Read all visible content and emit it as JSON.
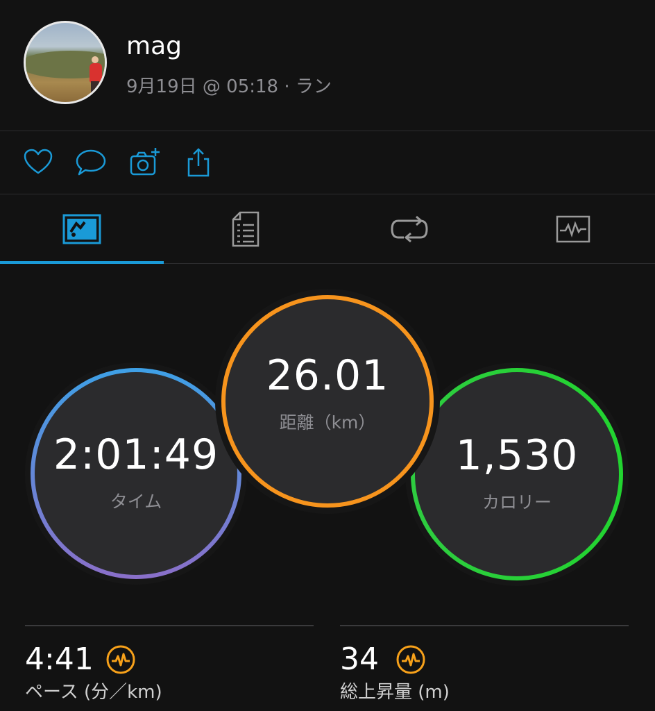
{
  "header": {
    "username": "mag",
    "subtitle": "9月19日 @ 05:18 · ラン"
  },
  "actions": [
    "heart-icon",
    "comment-icon",
    "add-photo-icon",
    "share-icon"
  ],
  "tabs": [
    {
      "icon": "overview-icon",
      "active": true
    },
    {
      "icon": "details-icon",
      "active": false
    },
    {
      "icon": "laps-icon",
      "active": false
    },
    {
      "icon": "charts-icon",
      "active": false
    }
  ],
  "metrics": {
    "time": {
      "value": "2:01:49",
      "label": "タイム"
    },
    "distance": {
      "value": "26.01",
      "label": "距離（km）"
    },
    "calories": {
      "value": "1,530",
      "label": "カロリー"
    }
  },
  "stats": {
    "pace": {
      "value": "4:41",
      "label": "ペース (分／km)"
    },
    "ascent": {
      "value": "34",
      "label": "総上昇量 (m)"
    }
  },
  "colors": {
    "accent_blue": "#1a9ad7",
    "ring_distance": "#f7941d",
    "ring_calories": "#2ecc40",
    "ring_time_start": "#3ea0e6",
    "ring_time_end": "#8a6fc9",
    "badge_orange": "#f7a11a"
  }
}
